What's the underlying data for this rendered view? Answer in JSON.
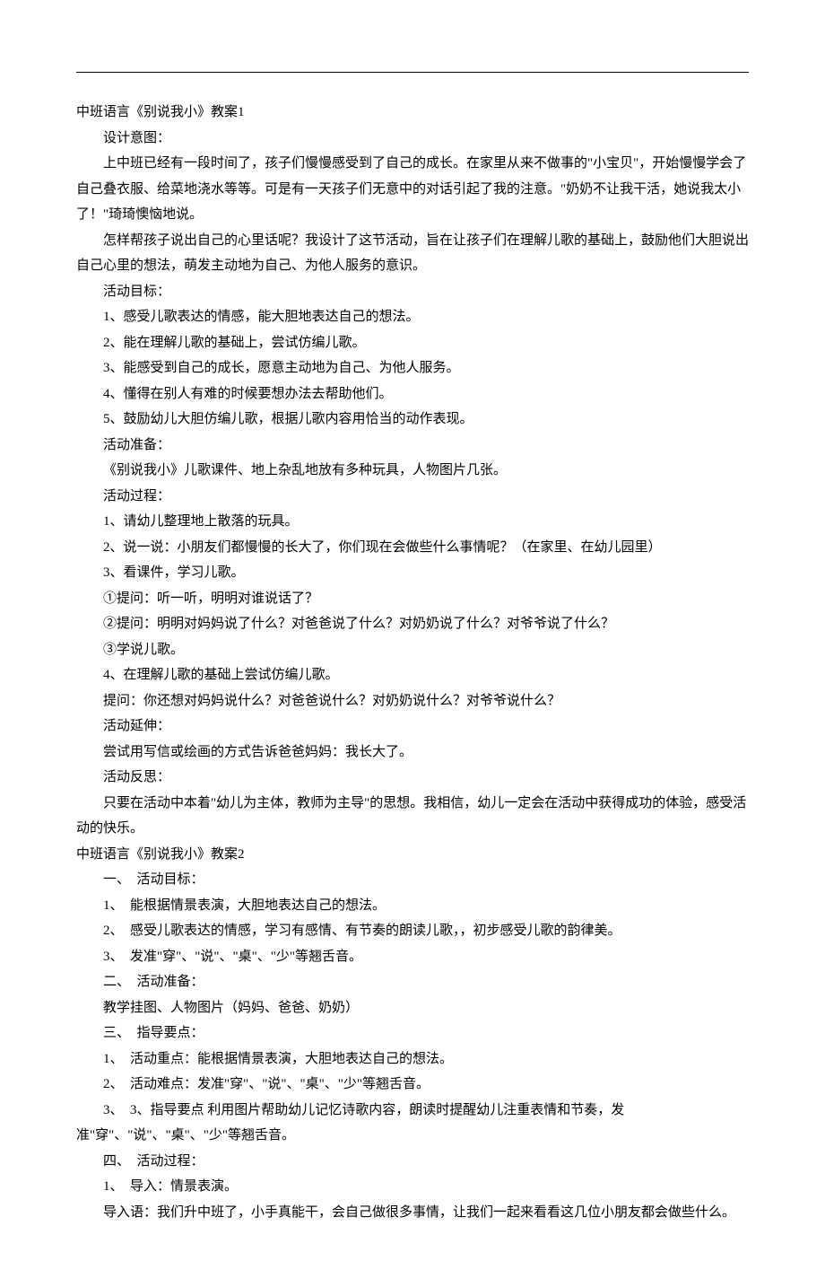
{
  "lines": [
    "中班语言《别说我小》教案1",
    "设计意图：",
    "上中班已经有一段时间了，孩子们慢慢感受到了自己的成长。在家里从来不做事的\"小宝贝\"，开始慢慢学会了自己叠衣服、给菜地浇水等等。可是有一天孩子们无意中的对话引起了我的注意。\"奶奶不让我干活，她说我太小了！\"琦琦懊恼地说。",
    "怎样帮孩子说出自己的心里话呢？我设计了这节活动，旨在让孩子们在理解儿歌的基础上，鼓励他们大胆说出自己心里的想法，萌发主动地为自己、为他人服务的意识。",
    "活动目标：",
    "1、感受儿歌表达的情感，能大胆地表达自己的想法。",
    "2、能在理解儿歌的基础上，尝试仿编儿歌。",
    "3、能感受到自己的成长，愿意主动地为自己、为他人服务。",
    "4、懂得在别人有难的时候要想办法去帮助他们。",
    "5、鼓励幼儿大胆仿编儿歌，根据儿歌内容用恰当的动作表现。",
    "活动准备：",
    "《别说我小》儿歌课件、地上杂乱地放有多种玩具，人物图片几张。",
    "活动过程：",
    "1、请幼儿整理地上散落的玩具。",
    "2、说一说：小朋友们都慢慢的长大了，你们现在会做些什么事情呢？（在家里、在幼儿园里）",
    "3、看课件，学习儿歌。",
    "①提问：听一听，明明对谁说话了？",
    "②提问：明明对妈妈说了什么？对爸爸说了什么？对奶奶说了什么？对爷爷说了什么？",
    "③学说儿歌。",
    "4、在理解儿歌的基础上尝试仿编儿歌。",
    "提问：你还想对妈妈说什么？对爸爸说什么？对奶奶说什么？对爷爷说什么？",
    "活动延伸：",
    "尝试用写信或绘画的方式告诉爸爸妈妈：我长大了。",
    "活动反思：",
    "只要在活动中本着\"幼儿为主体，教师为主导\"的思想。我相信，幼儿一定会在活动中获得成功的体验，感受活动的快乐。",
    "中班语言《别说我小》教案2",
    "一、　活动目标：",
    "1、　能根据情景表演，大胆地表达自己的想法。",
    "2、　感受儿歌表达的情感，学习有感情、有节奏的朗读儿歌，，初步感受儿歌的韵律美。",
    "3、　发准\"穿\"、\"说\"、\"桌\"、\"少\"等翘舌音。",
    "二、　活动准备：",
    "教学挂图、人物图片（妈妈、爸爸、奶奶）",
    "三、　指导要点：",
    "1、　活动重点：能根据情景表演，大胆地表达自己的想法。",
    "2、　活动难点：发准\"穿\"、\"说\"、\"桌\"、\"少\"等翘舌音。",
    "3、　3、指导要点 利用图片帮助幼儿记忆诗歌内容，朗读时提醒幼儿注重表情和节奏，发准\"穿\"、\"说\"、\"桌\"、\"少\"等翘舌音。",
    "四、　活动过程：",
    "1、　导入：情景表演。",
    "导入语：我们升中班了，小手真能干，会自己做很多事情，让我们一起来看看这几位小朋友都会做些什么。"
  ],
  "noIndentIndices": [
    0,
    25
  ]
}
